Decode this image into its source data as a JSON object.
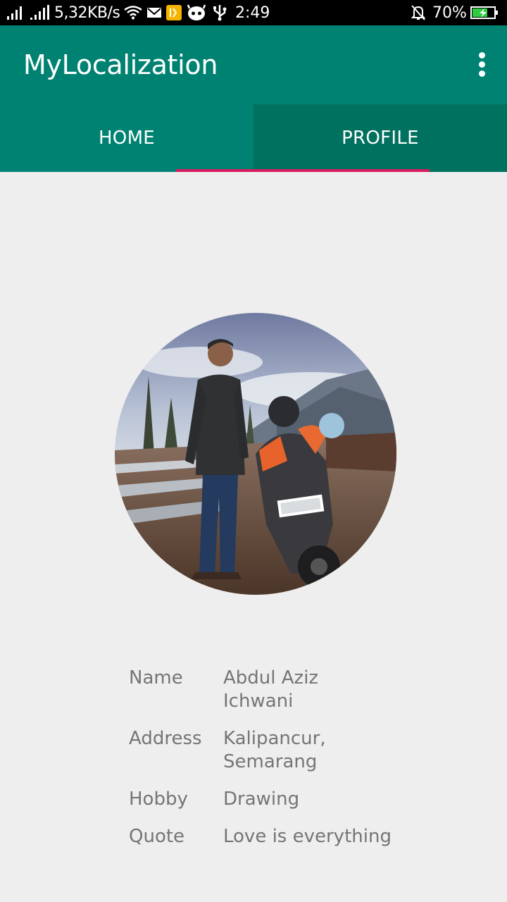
{
  "status_bar": {
    "network_speed": "5,32KB/s",
    "time": "2:49",
    "battery_percent": "70%",
    "battery_level": 0.7,
    "icons": [
      "signal-icon",
      "signal-icon",
      "wifi-icon",
      "mail-icon",
      "app-icon",
      "android-icon",
      "usb-icon",
      "bell-muted-icon",
      "battery-charging-icon"
    ]
  },
  "app_bar": {
    "title": "MyLocalization",
    "menu_icon": "more-vert-icon"
  },
  "tabs": [
    {
      "label": "HOME",
      "selected": false
    },
    {
      "label": "PROFILE",
      "selected": true
    }
  ],
  "colors": {
    "primary": "#008272",
    "primary_dark": "#00705f",
    "accent": "#d81b60",
    "background": "#eeeeee",
    "text_secondary": "#757575"
  },
  "profile": {
    "avatar_alt": "profile-photo",
    "fields": [
      {
        "label": "Name",
        "value": "Abdul Aziz Ichwani"
      },
      {
        "label": "Address",
        "value": "Kalipancur, Semarang"
      },
      {
        "label": "Hobby",
        "value": "Drawing"
      },
      {
        "label": "Quote",
        "value": "Love is everything"
      }
    ]
  }
}
